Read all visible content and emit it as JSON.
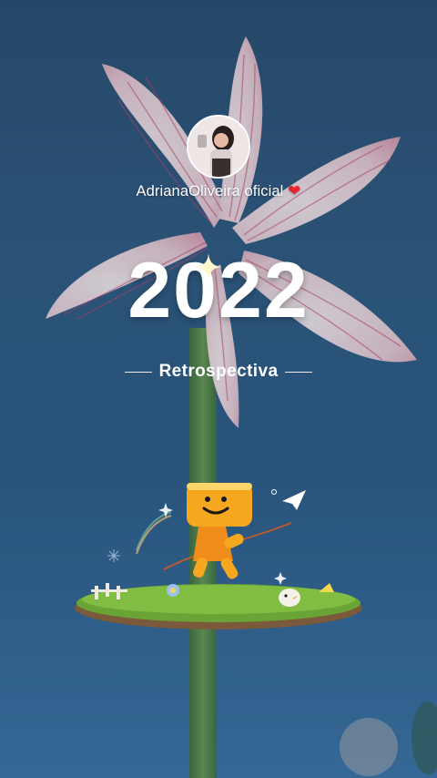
{
  "user": {
    "display_name": "AdrianaOliveira oficial",
    "avatar_label": "avatar"
  },
  "title": {
    "year": "2022",
    "subtitle": "Retrospectiva"
  },
  "icons": {
    "heart": "heart-icon",
    "sparkle": "sparkle-icon",
    "paper_plane": "paper-plane-icon"
  },
  "colors": {
    "heart": "#e5242c",
    "text": "#ffffff"
  }
}
